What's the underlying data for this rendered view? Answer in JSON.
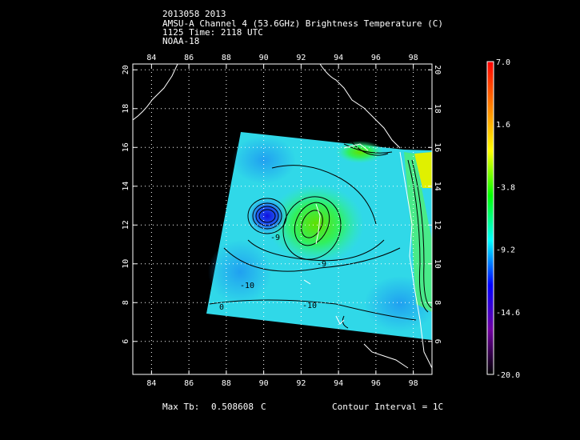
{
  "title": {
    "line1": "2013058 2013",
    "line2": "AMSU-A Channel 4 (53.6GHz) Brightness Temperature (C)",
    "line3": "1125 Time: 2118 UTC",
    "line4": "NOAA-18"
  },
  "map": {
    "lon_range": [
      83,
      99
    ],
    "lat_range": [
      4.3,
      20.3
    ],
    "lon_ticks": [
      84,
      86,
      88,
      90,
      92,
      94,
      96,
      98
    ],
    "lat_ticks": [
      6,
      8,
      10,
      12,
      14,
      16,
      18,
      20
    ],
    "grid": "dotted",
    "contour_labels": [
      "-9",
      "-9",
      "-10",
      "-10",
      "0"
    ]
  },
  "colorbar": {
    "labels": [
      "7.0",
      "1.6",
      "-3.8",
      "-9.2",
      "-14.6",
      "-20.0"
    ],
    "range": [
      -20.0,
      7.0
    ],
    "colors": [
      "#000000",
      "#7000a0",
      "#0000ff",
      "#00ffff",
      "#00ff00",
      "#ffff00",
      "#ff8000",
      "#ff0000"
    ]
  },
  "footer": {
    "max_tb_label": "Max Tb:",
    "max_tb_value": "0.508608",
    "max_tb_unit": "C",
    "contour_interval": "Contour Interval = 1C"
  }
}
